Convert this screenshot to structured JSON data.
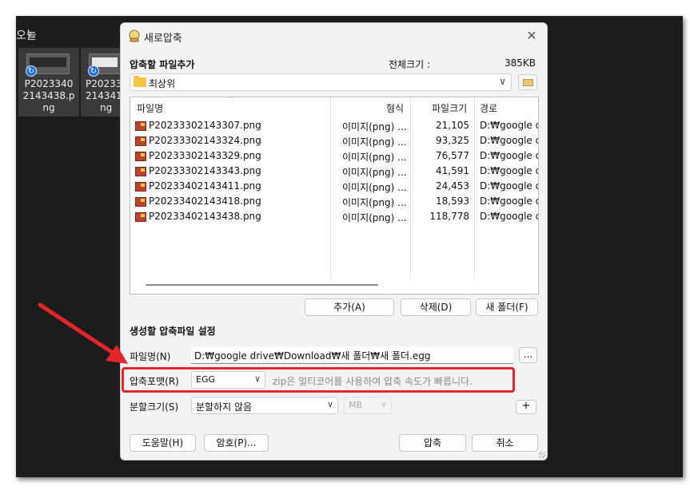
{
  "explorer": {
    "group_label": "오늘",
    "tiles": [
      {
        "name_lines": [
          "P2023340",
          "2143438.p",
          "ng"
        ]
      },
      {
        "name_lines": [
          "P20233",
          "214341",
          "ng"
        ]
      }
    ]
  },
  "dialog": {
    "title": "새로압축",
    "close_glyph": "✕",
    "add_section_title": "압축할 파일추가",
    "total_label": "전체크기 :",
    "total_value": "385KB",
    "folder": "최상위",
    "columns": {
      "name": "파일명",
      "type": "형식",
      "size": "파일크기",
      "path": "경로"
    },
    "files": [
      {
        "name": "P20233302143307.png",
        "type": "이미지(png) ...",
        "size": "21,105",
        "path": "D:₩google dr"
      },
      {
        "name": "P20233302143324.png",
        "type": "이미지(png) ...",
        "size": "93,325",
        "path": "D:₩google dr"
      },
      {
        "name": "P20233302143329.png",
        "type": "이미지(png) ...",
        "size": "76,577",
        "path": "D:₩google dr"
      },
      {
        "name": "P20233302143343.png",
        "type": "이미지(png) ...",
        "size": "41,591",
        "path": "D:₩google dr"
      },
      {
        "name": "P20233402143411.png",
        "type": "이미지(png) ...",
        "size": "24,453",
        "path": "D:₩google dr"
      },
      {
        "name": "P20233402143418.png",
        "type": "이미지(png) ...",
        "size": "18,593",
        "path": "D:₩google dr"
      },
      {
        "name": "P20233402143438.png",
        "type": "이미지(png) ...",
        "size": "118,778",
        "path": "D:₩google dr"
      }
    ],
    "buttons": {
      "add": "추가(A)",
      "delete": "삭제(D)",
      "new_folder": "새 폴더(F)",
      "browse": "...",
      "plus": "+",
      "help": "도움말(H)",
      "password": "암호(P)...",
      "compress": "압축",
      "cancel": "취소"
    },
    "settings_section_title": "생성할 압축파일 설정",
    "filename_label": "파일명(N)",
    "filename_value": "D:₩google drive₩Download₩새 폴더₩새 폴더.egg",
    "format_label": "압축포맷(R)",
    "format_value": "EGG",
    "format_desc": "zip은 멀티코어를 사용하여 압축 속도가 빠릅니다.",
    "split_label": "분할크기(S)",
    "split_value": "분할하지 않음",
    "unit_value": "MB"
  },
  "colors": {
    "highlight": "#e4262b",
    "arrow": "#e4262b"
  }
}
